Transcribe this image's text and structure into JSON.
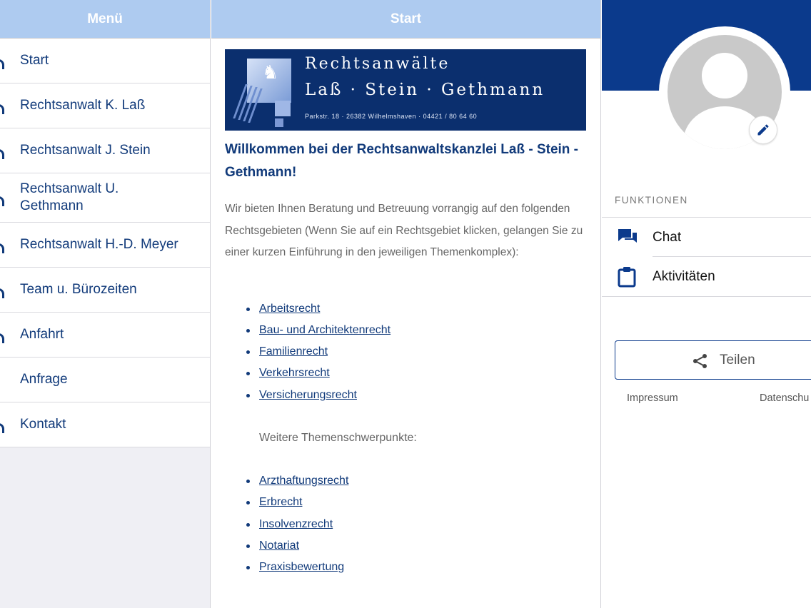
{
  "menu": {
    "title": "Menü",
    "items": [
      {
        "label": "Start"
      },
      {
        "label": "Rechtsanwalt K. Laß"
      },
      {
        "label": "Rechtsanwalt J. Stein"
      },
      {
        "label": "Rechtsanwalt U. Gethmann"
      },
      {
        "label": "Rechtsanwalt H.-D. Meyer"
      },
      {
        "label": "Team u. Bürozeiten"
      },
      {
        "label": "Anfahrt"
      },
      {
        "label": "Anfrage"
      },
      {
        "label": "Kontakt"
      }
    ]
  },
  "center": {
    "title": "Start",
    "banner": {
      "line1": "Rechtsanwälte",
      "line2": "Laß · Stein · Gethmann",
      "line3": "Parkstr. 18 · 26382 Wilhelmshaven · 04421 / 80 64 60"
    },
    "heading": "Willkommen bei der Rechtsanwaltskanzlei Laß - Stein - Gethmann!",
    "intro": "Wir bieten Ihnen Beratung und Betreuung vorrangig auf den folgenden Rechtsgebieten (Wenn Sie auf ein Rechtsgebiet klicken, gelangen Sie zu einer kurzen Einführung in den jeweiligen Themenkomplex):",
    "links": [
      {
        "label": "Arbeitsrecht"
      },
      {
        "label": "Bau- und Architektenrecht"
      },
      {
        "label": "Familienrecht"
      },
      {
        "label": "Verkehrsrecht"
      },
      {
        "label": "Versicherungsrecht"
      }
    ],
    "further_label": "Weitere Themenschwerpunkte:",
    "links2": [
      {
        "label": "Arzthaftungsrecht"
      },
      {
        "label": "Erbrecht"
      },
      {
        "label": "Insolvenzrecht"
      },
      {
        "label": "Notariat"
      },
      {
        "label": "Praxisbewertung"
      }
    ]
  },
  "right": {
    "section_label": "FUNKTIONEN",
    "functions": [
      {
        "label": "Chat",
        "icon": "chat-icon"
      },
      {
        "label": "Aktivitäten",
        "icon": "clipboard-icon"
      }
    ],
    "share_label": "Teilen",
    "footer_left": "Impressum",
    "footer_right": "Datenschu"
  },
  "colors": {
    "header_bg": "#aecbf0",
    "brand_blue": "#0b3a8c",
    "text_blue": "#113a7a"
  }
}
